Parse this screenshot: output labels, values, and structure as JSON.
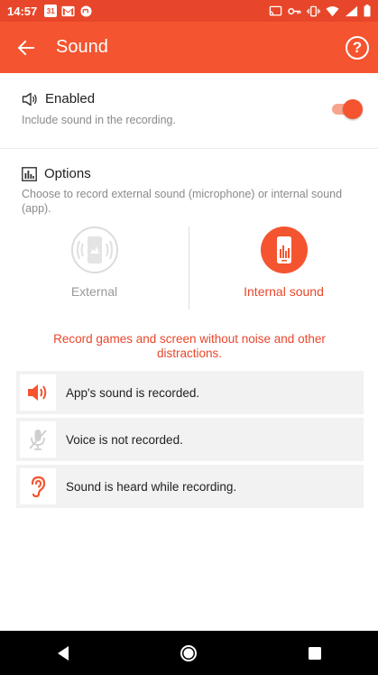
{
  "status_bar": {
    "time": "14:57",
    "calendar_day": "31"
  },
  "app_bar": {
    "title": "Sound",
    "help_symbol": "?"
  },
  "enabled_section": {
    "title": "Enabled",
    "subtitle": "Include sound in the recording.",
    "toggle_on": true
  },
  "options_section": {
    "title": "Options",
    "subtitle": "Choose to record external sound (microphone) or internal sound (app).",
    "choices": [
      {
        "label": "External",
        "selected": false
      },
      {
        "label": "Internal sound",
        "selected": true
      }
    ],
    "hint": "Record games and screen without noise and other distractions."
  },
  "info_items": [
    {
      "icon": "speaker-icon",
      "text": "App's sound is recorded."
    },
    {
      "icon": "mic-off-icon",
      "text": "Voice is not recorded."
    },
    {
      "icon": "ear-icon",
      "text": "Sound is heard while recording."
    }
  ],
  "colors": {
    "accent": "#f4542f",
    "status_bar": "#e8462a",
    "toggle_track": "#f8a48d",
    "card_bg": "#f2f2f2"
  }
}
